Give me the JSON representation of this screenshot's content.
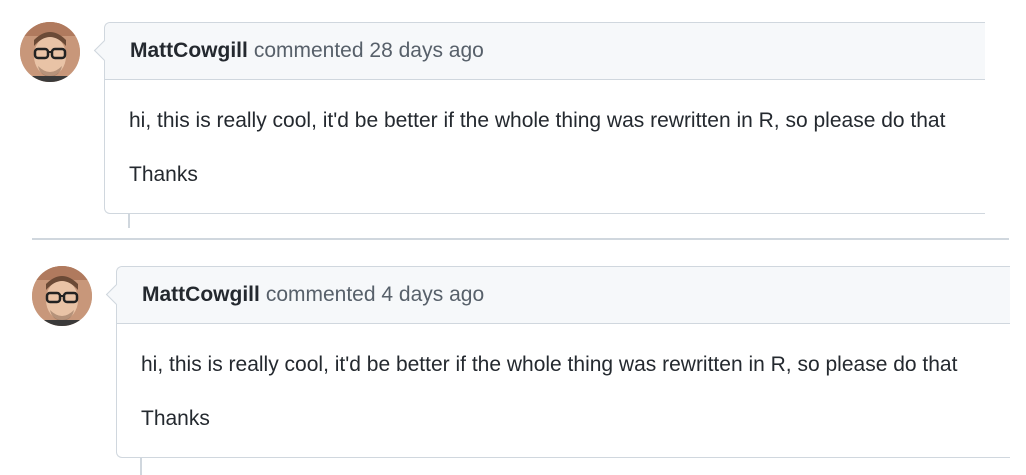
{
  "comments": [
    {
      "author": "MattCowgill",
      "action": "commented",
      "time": "28 days ago",
      "paragraphs": [
        "hi, this is really cool, it'd be better if the whole thing was rewritten in R, so please do that",
        "Thanks"
      ]
    },
    {
      "author": "MattCowgill",
      "action": "commented",
      "time": "4 days ago",
      "paragraphs": [
        "hi, this is really cool, it'd be better if the whole thing was rewritten in R, so please do that",
        "Thanks"
      ]
    }
  ],
  "colors": {
    "border": "#d0d7de",
    "header_bg": "#f6f8fa",
    "muted_text": "#57606a",
    "text": "#24292f"
  }
}
